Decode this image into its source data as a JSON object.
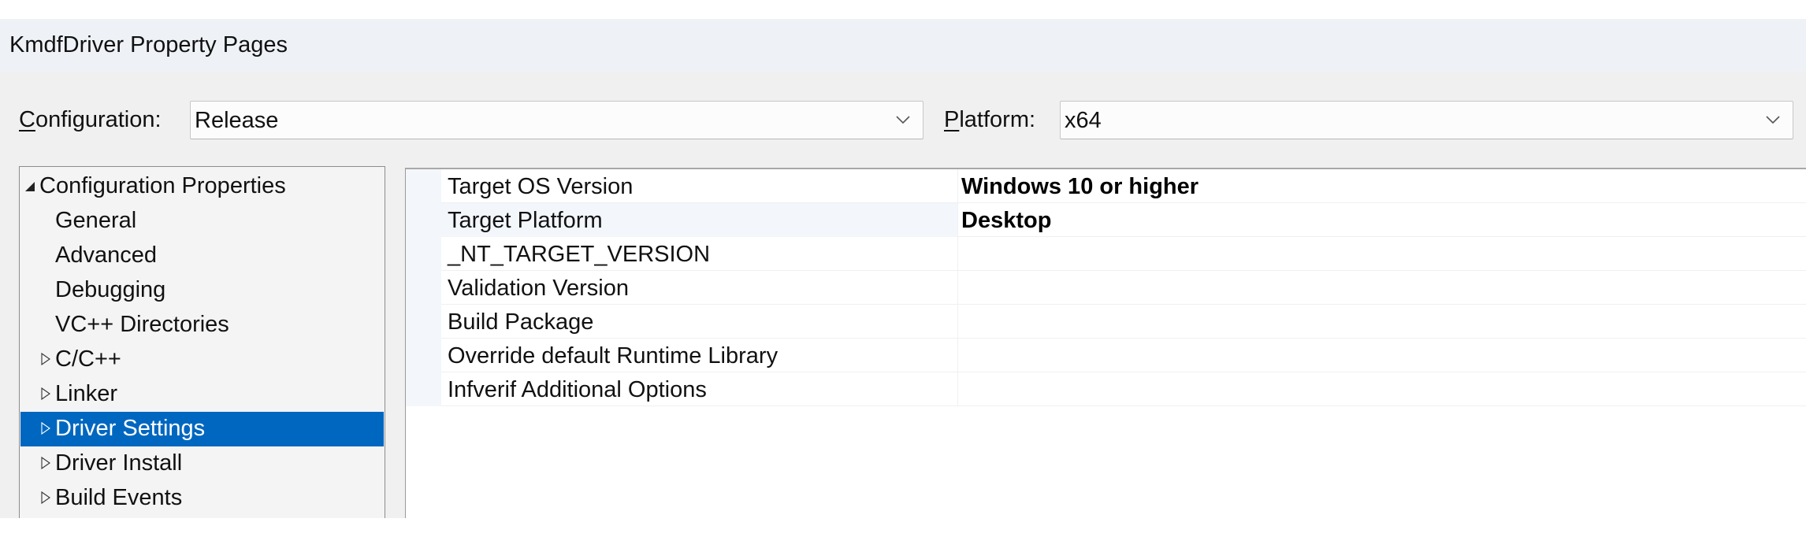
{
  "window": {
    "title": "KmdfDriver Property Pages"
  },
  "config_bar": {
    "configuration_label_accel": "C",
    "configuration_label_rest": "onfiguration:",
    "configuration_value": "Release",
    "platform_label_accel": "P",
    "platform_label_rest": "latform:",
    "platform_value": "x64"
  },
  "tree": {
    "items": [
      {
        "label": "Configuration Properties",
        "level": 0,
        "expander": "expanded",
        "selected": false
      },
      {
        "label": "General",
        "level": 1,
        "expander": "none",
        "selected": false
      },
      {
        "label": "Advanced",
        "level": 1,
        "expander": "none",
        "selected": false
      },
      {
        "label": "Debugging",
        "level": 1,
        "expander": "none",
        "selected": false
      },
      {
        "label": "VC++ Directories",
        "level": 1,
        "expander": "none",
        "selected": false
      },
      {
        "label": "C/C++",
        "level": 1,
        "expander": "collapsed",
        "selected": false
      },
      {
        "label": "Linker",
        "level": 1,
        "expander": "collapsed",
        "selected": false
      },
      {
        "label": "Driver Settings",
        "level": 1,
        "expander": "collapsed",
        "selected": true
      },
      {
        "label": "Driver Install",
        "level": 1,
        "expander": "collapsed",
        "selected": false
      },
      {
        "label": "Build Events",
        "level": 1,
        "expander": "collapsed",
        "selected": false
      }
    ]
  },
  "properties": {
    "rows": [
      {
        "name": "Target OS Version",
        "value": "Windows 10 or higher",
        "selected": false
      },
      {
        "name": "Target Platform",
        "value": "Desktop",
        "selected": true
      },
      {
        "name": "_NT_TARGET_VERSION",
        "value": "",
        "selected": false
      },
      {
        "name": "Validation Version",
        "value": "",
        "selected": false
      },
      {
        "name": "Build Package",
        "value": "",
        "selected": false
      },
      {
        "name": "Override default Runtime Library",
        "value": "",
        "selected": false
      },
      {
        "name": "Infverif Additional Options",
        "value": "",
        "selected": false
      }
    ]
  },
  "colors": {
    "selection_accent": "#0067c0",
    "titlebar_bg": "#eef2f7",
    "dialog_bg": "#f0f0f0"
  }
}
